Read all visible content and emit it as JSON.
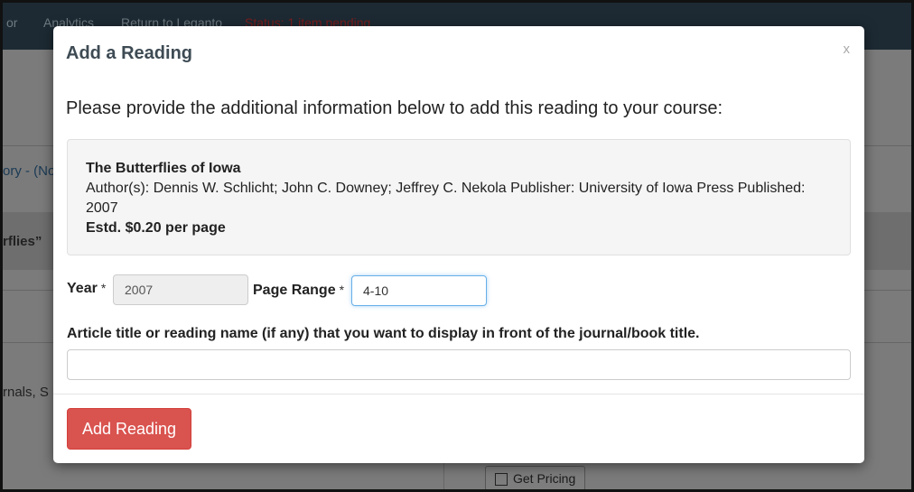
{
  "background": {
    "nav": {
      "item_1": "or",
      "item_2": "Analytics",
      "item_3": "Return to Leganto",
      "item_4": "Status: 1 item pending"
    },
    "breadcrumb_fragment": "ory - (No",
    "heading_fragment": "rflies”",
    "text_fragment": "rnals, S",
    "get_pricing_label": "Get Pricing"
  },
  "modal": {
    "title": "Add a Reading",
    "close_label": "x",
    "intro": "Please provide the additional information below to add this reading to your course:",
    "book": {
      "title": "The Butterflies of Iowa",
      "details": "Author(s): Dennis W. Schlicht; John C. Downey; Jeffrey C. Nekola  Publisher: University of Iowa Press  Published: 2007",
      "price": "Estd. $0.20 per page"
    },
    "year": {
      "label": "Year",
      "required_mark": "*",
      "value": "2007"
    },
    "page_range": {
      "label": "Page Range",
      "required_mark": "*",
      "value": "4-10"
    },
    "article": {
      "label": "Article title or reading name (if any) that you want to display in front of the journal/book title.",
      "value": ""
    },
    "submit_label": "Add Reading"
  },
  "colors": {
    "primary_button": "#d9534f",
    "focus_border": "#66afe9",
    "title_text": "#3e4b54"
  }
}
